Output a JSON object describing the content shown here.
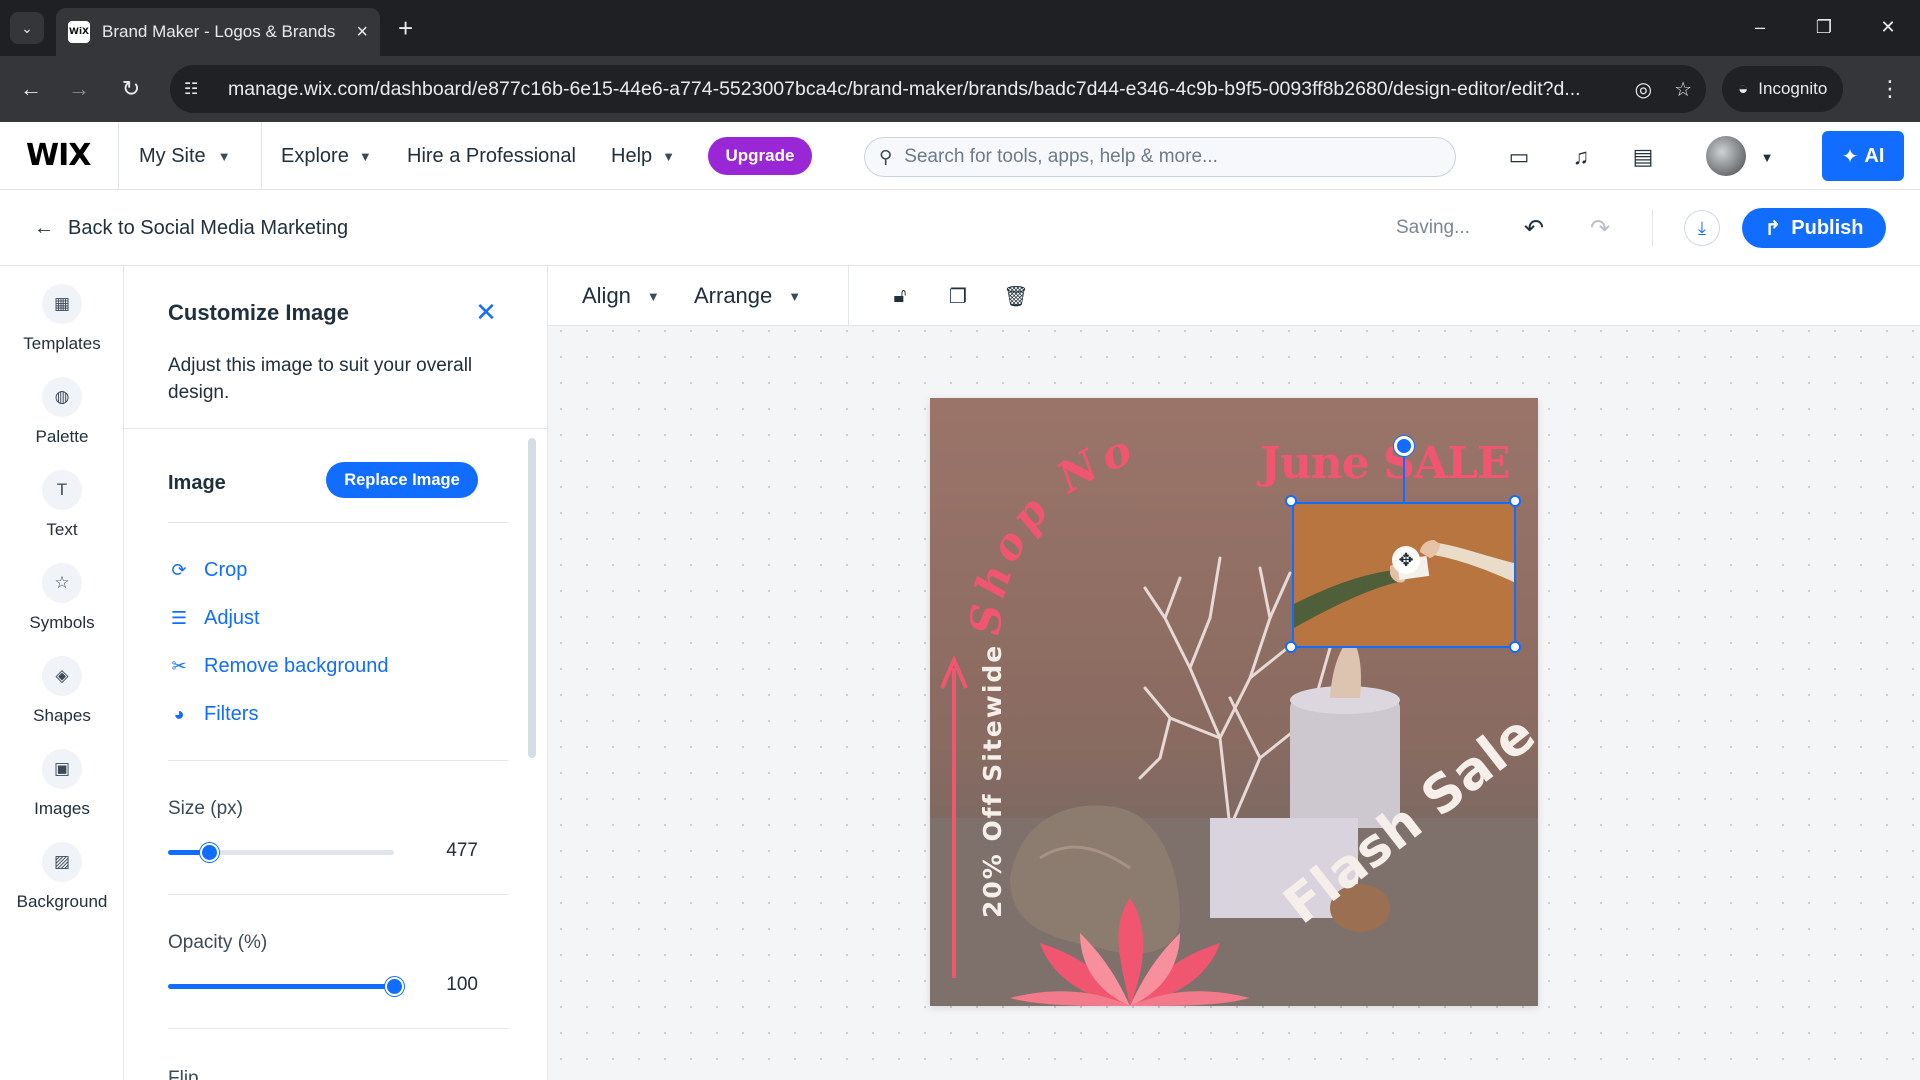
{
  "browser": {
    "tab_title": "Brand Maker - Logos & Brands",
    "favicon_text": "WiX",
    "url": "manage.wix.com/dashboard/e877c16b-6e15-44e6-a774-5523007bca4c/brand-maker/brands/badc7d44-e346-4c9b-b9f5-0093ff8b2680/design-editor/edit?d...",
    "incognito_label": "Incognito",
    "icons": [
      "tab-list-icon",
      "close-icon",
      "plus-icon",
      "minimize-icon",
      "restore-icon",
      "back-arrow-icon",
      "forward-arrow-icon",
      "reload-icon",
      "site-info-icon",
      "eye-off-icon",
      "star-icon",
      "incognito-icon",
      "more-vert-icon"
    ]
  },
  "topbar": {
    "logo": "WIX",
    "my_site": "My Site",
    "nav": [
      "Explore",
      "Hire a Professional",
      "Help"
    ],
    "upgrade": "Upgrade",
    "search_placeholder": "Search for tools, apps, help & more...",
    "ai_label": "AI",
    "colors": {
      "upgrade": "#9a27d5",
      "primary": "#116dff"
    }
  },
  "subbar": {
    "back_label": "Back to Social Media Marketing",
    "status": "Saving...",
    "publish": "Publish"
  },
  "rail": {
    "items": [
      {
        "label": "Templates",
        "icon": "templates-icon"
      },
      {
        "label": "Palette",
        "icon": "palette-icon"
      },
      {
        "label": "Text",
        "icon": "text-icon"
      },
      {
        "label": "Symbols",
        "icon": "star-icon"
      },
      {
        "label": "Shapes",
        "icon": "shapes-icon"
      },
      {
        "label": "Images",
        "icon": "image-icon"
      },
      {
        "label": "Background",
        "icon": "background-icon"
      }
    ]
  },
  "panel": {
    "title": "Customize Image",
    "description": "Adjust this image to suit your overall design.",
    "image_section": "Image",
    "replace_button": "Replace Image",
    "actions": [
      "Crop",
      "Adjust",
      "Remove background",
      "Filters"
    ],
    "size_label": "Size (px)",
    "size_value": "477",
    "size_fraction": 0.18,
    "opacity_label": "Opacity (%)",
    "opacity_value": "100",
    "opacity_fraction": 1.0,
    "flip_label": "Flip"
  },
  "canvas_toolbar": {
    "align": "Align",
    "arrange": "Arrange"
  },
  "design": {
    "shop_now": "Shop Now",
    "june_sale": "June SALE",
    "off_sitewide": "20% Off Sitewide",
    "flash_sale": "Flash Sale",
    "colors": {
      "pink": "#f0566f",
      "cream": "#f5eee9"
    }
  }
}
